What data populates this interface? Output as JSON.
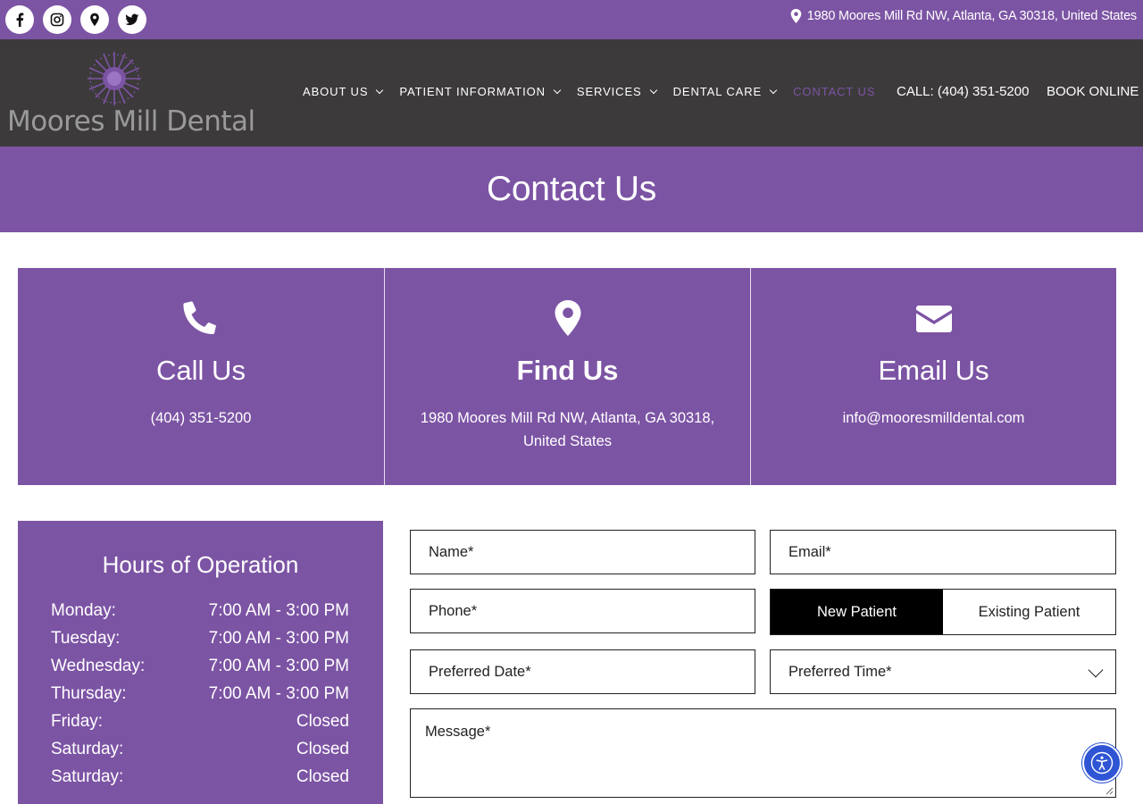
{
  "topbar": {
    "social": [
      {
        "icon": "facebook-icon"
      },
      {
        "icon": "instagram-icon"
      },
      {
        "icon": "map-pin-icon"
      },
      {
        "icon": "twitter-icon"
      }
    ],
    "address": "1980 Moores Mill Rd NW, Atlanta, GA 30318, United States"
  },
  "header": {
    "logo_text": "Moores Mill Dental",
    "nav": [
      {
        "label": "ABOUT US",
        "dropdown": true
      },
      {
        "label": "PATIENT INFORMATION",
        "dropdown": true
      },
      {
        "label": "SERVICES",
        "dropdown": true
      },
      {
        "label": "DENTAL CARE",
        "dropdown": true
      },
      {
        "label": "CONTACT US",
        "dropdown": false,
        "active": true
      }
    ],
    "call_label": "CALL: (404) 351-5200",
    "book_label": "BOOK ONLINE"
  },
  "page_title": "Contact Us",
  "cards": [
    {
      "icon": "phone-icon",
      "title": "Call Us",
      "text": "(404) 351-5200"
    },
    {
      "icon": "location-pin-icon",
      "title": "Find Us",
      "text": "1980 Moores Mill Rd NW, Atlanta, GA 30318, United States"
    },
    {
      "icon": "envelope-icon",
      "title": "Email Us",
      "text": "info@mooresmilldental.com"
    }
  ],
  "hours": {
    "title": "Hours of Operation",
    "rows": [
      {
        "day": "Monday:",
        "time": "7:00 AM - 3:00 PM"
      },
      {
        "day": "Tuesday:",
        "time": "7:00 AM - 3:00 PM"
      },
      {
        "day": "Wednesday:",
        "time": "7:00 AM - 3:00 PM"
      },
      {
        "day": "Thursday:",
        "time": "7:00 AM - 3:00 PM"
      },
      {
        "day": "Friday:",
        "time": "Closed"
      },
      {
        "day": "Saturday:",
        "time": "Closed"
      },
      {
        "day": "Saturday:",
        "time": "Closed"
      }
    ]
  },
  "form": {
    "name_placeholder": "Name*",
    "email_placeholder": "Email*",
    "phone_placeholder": "Phone*",
    "patient_options": [
      "New Patient",
      "Existing Patient"
    ],
    "patient_selected": "New Patient",
    "date_placeholder": "Preferred Date*",
    "time_placeholder": "Preferred Time*",
    "message_placeholder": "Message*"
  },
  "colors": {
    "brand_purple": "#7c54a4",
    "header_dark": "#3d3a3b",
    "accessibility_blue": "#2f55d4"
  }
}
